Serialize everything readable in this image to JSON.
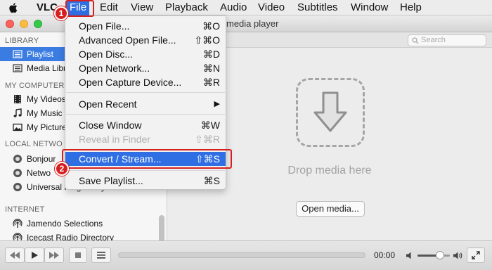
{
  "menubar": {
    "app": "VLC",
    "items": [
      "File",
      "Edit",
      "View",
      "Playback",
      "Audio",
      "Video",
      "Subtitles",
      "Window",
      "Help"
    ]
  },
  "window": {
    "title": "media player",
    "search_placeholder": "Search"
  },
  "sidebar": {
    "sections": [
      {
        "title": "LIBRARY",
        "items": [
          {
            "label": "Playlist",
            "icon": "playlist-icon",
            "selected": true
          },
          {
            "label": "Media Libr",
            "icon": "media-library-icon"
          }
        ]
      },
      {
        "title": "MY COMPUTER",
        "items": [
          {
            "label": "My Videos",
            "icon": "film-icon"
          },
          {
            "label": "My Music",
            "icon": "music-note-icon"
          },
          {
            "label": "My Picture",
            "icon": "picture-icon"
          }
        ]
      },
      {
        "title": "LOCAL NETWO",
        "items": [
          {
            "label": "Bonjour",
            "icon": "bonjour-icon"
          },
          {
            "label": "Netwo",
            "icon": "network-icon"
          },
          {
            "label": "Universal Plug'n'Play",
            "icon": "upnp-icon"
          }
        ]
      },
      {
        "title": "INTERNET",
        "items": [
          {
            "label": "Jamendo Selections",
            "icon": "podcast-icon"
          },
          {
            "label": "Icecast Radio Directory",
            "icon": "podcast-icon"
          }
        ]
      }
    ]
  },
  "main": {
    "drop_text": "Drop media here",
    "open_button": "Open media..."
  },
  "controls": {
    "time": "00:00",
    "volume": 0.7
  },
  "file_menu": {
    "items": [
      {
        "label": "Open File...",
        "shortcut": "⌘O"
      },
      {
        "label": "Advanced Open File...",
        "shortcut": "⇧⌘O"
      },
      {
        "label": "Open Disc...",
        "shortcut": "⌘D"
      },
      {
        "label": "Open Network...",
        "shortcut": "⌘N"
      },
      {
        "label": "Open Capture Device...",
        "shortcut": "⌘R"
      },
      {
        "label": "Open Recent",
        "shortcut": "▶"
      },
      {
        "label": "Close Window",
        "shortcut": "⌘W"
      },
      {
        "label": "Reveal in Finder",
        "shortcut": "⇧⌘R",
        "disabled": true
      },
      {
        "label": "Convert / Stream...",
        "shortcut": "⇧⌘S",
        "highlighted": true
      },
      {
        "label": "Save Playlist...",
        "shortcut": "⌘S"
      }
    ]
  },
  "annotations": {
    "step1": "1",
    "step2": "2",
    "color": "#d62020"
  },
  "colors": {
    "accent": "#2f6fe3",
    "selection": "#3b7ce3"
  }
}
